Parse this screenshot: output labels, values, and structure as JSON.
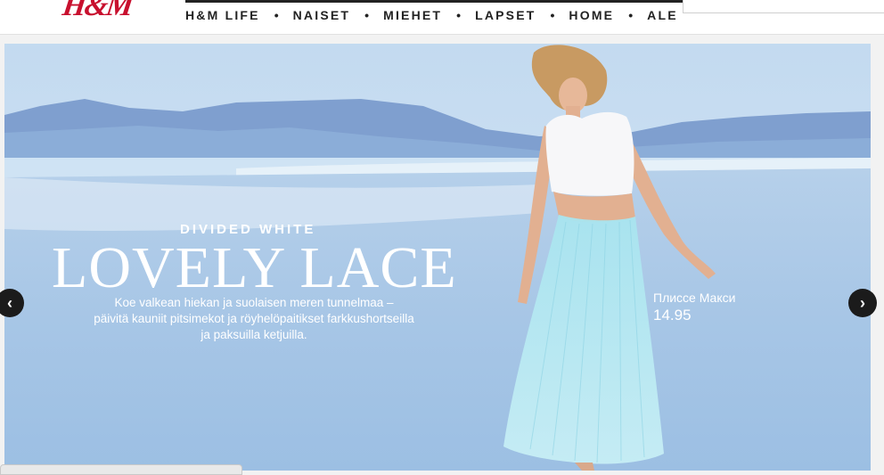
{
  "header": {
    "logo_text": "H&M",
    "nav": [
      {
        "label": "H&M LIFE"
      },
      {
        "label": "NAISET"
      },
      {
        "label": "MIEHET"
      },
      {
        "label": "LAPSET"
      },
      {
        "label": "HOME"
      },
      {
        "label": "ALE"
      }
    ],
    "separator": "•"
  },
  "hero": {
    "eyebrow": "DIVIDED WHITE",
    "headline": "LOVELY LACE",
    "description_lines": [
      "Koe valkean hiekan ja suolaisen meren tunnelmaa –",
      "päivitä kauniit pitsimekot ja röyhelöpaitikset farkkushortseilla",
      "ja paksuilla ketjuilla."
    ],
    "product": {
      "name": "Плиссе Макси",
      "price": "14.95"
    }
  },
  "carousel": {
    "prev_icon": "chevron-left-icon",
    "next_icon": "chevron-right-icon"
  },
  "colors": {
    "brand": "#c8102e",
    "sky": "#bdd6ef",
    "sea": "#9fc3e6",
    "mountain": "#6c8fc4",
    "skirt": "#a9e3ef"
  }
}
